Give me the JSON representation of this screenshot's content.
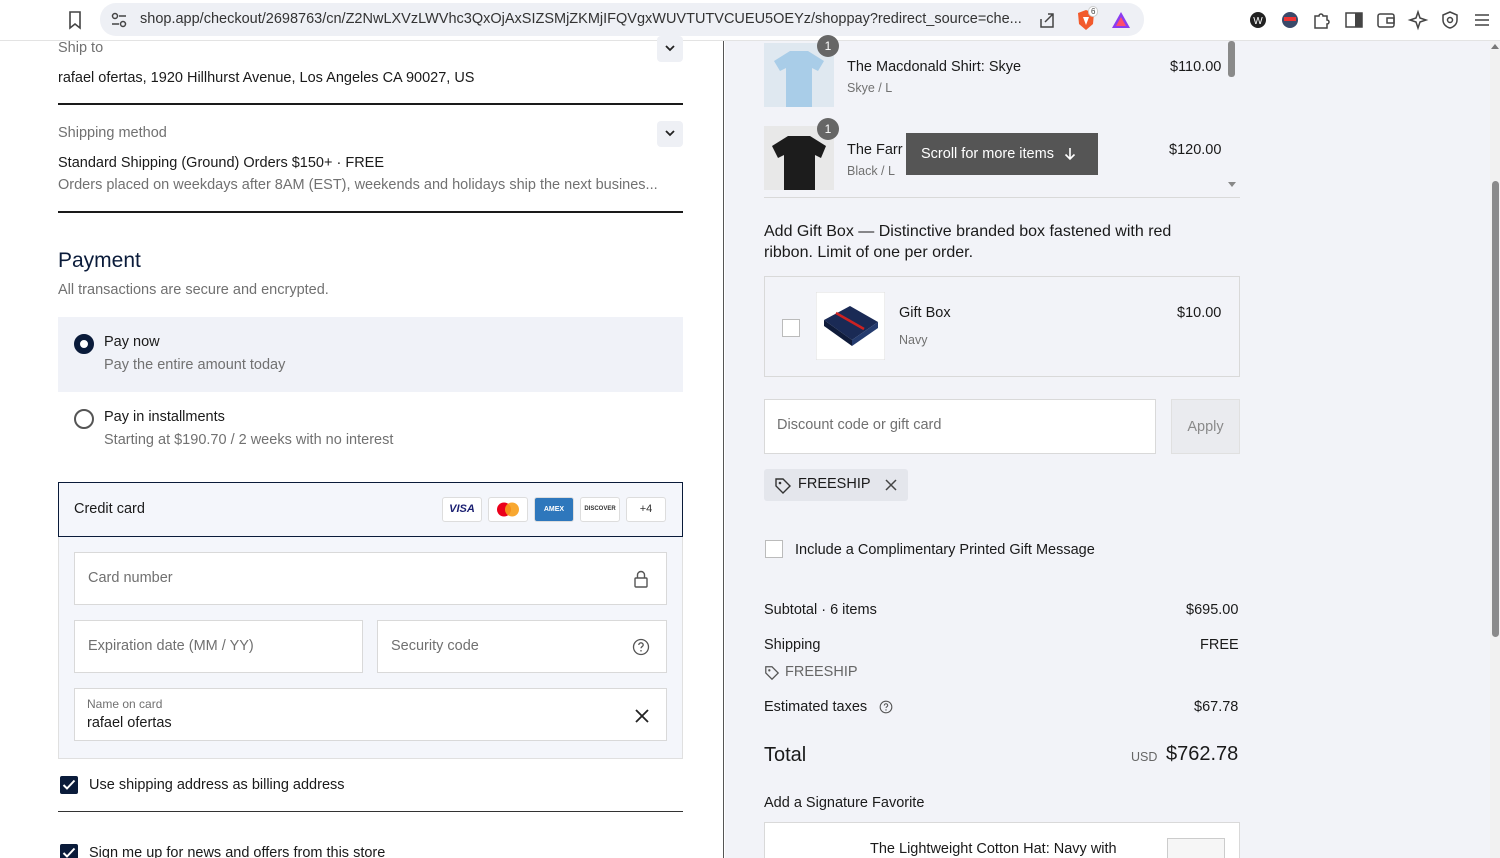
{
  "browser": {
    "url": "shop.app/checkout/2698763/cn/Z2NwLXVzLWVhc3QxOjAxSIZSMjZKMjIFQVgxWUVTUTVCUEU5OEYz/shoppay?redirect_source=che...",
    "brave_badge": "6",
    "icons": [
      "bookmark-icon",
      "tune-icon",
      "share-icon",
      "brave-shield-icon",
      "brave-rewards-icon",
      "extension-icon",
      "sidebar-icon",
      "wallet-icon",
      "leo-icon",
      "vpn-icon",
      "menu-icon"
    ]
  },
  "shipping": {
    "ship_to_label": "Ship to",
    "ship_to_value": "rafael ofertas, 1920 Hillhurst Avenue, Los Angeles CA 90027, US",
    "method_label": "Shipping method",
    "method_value": "Standard Shipping (Ground) Orders $150+ · FREE",
    "method_note": "Orders placed on weekdays after 8AM (EST), weekends and holidays ship the next busines..."
  },
  "payment": {
    "heading": "Payment",
    "subtitle": "All transactions are secure and encrypted.",
    "pay_now_label": "Pay now",
    "pay_now_sub": "Pay the entire amount today",
    "installments_label": "Pay in installments",
    "installments_sub": "Starting at $190.70 / 2 weeks with no interest",
    "credit_card_label": "Credit card",
    "card_brands": [
      "VISA",
      "MC",
      "AMEX",
      "DISCOVER"
    ],
    "more_brands": "+4",
    "card_number_placeholder": "Card number",
    "expiry_placeholder": "Expiration date (MM / YY)",
    "security_placeholder": "Security code",
    "name_label": "Name on card",
    "name_value": "rafael ofertas",
    "billing_same": "Use shipping address as billing address",
    "newsletter": "Sign me up for news and offers from this store"
  },
  "cart": {
    "items": [
      {
        "qty": "1",
        "name": "The Macdonald Shirt: Skye",
        "variant": "Skye / L",
        "price": "$110.00",
        "color": "#a9cde8"
      },
      {
        "qty": "1",
        "name": "The Farr",
        "variant": "Black / L",
        "price": "$120.00",
        "color": "#1c1c1c"
      }
    ],
    "scroll_tooltip": "Scroll for more items",
    "gift_box_heading": "Add Gift Box — Distinctive branded box fastened with red ribbon. Limit of one per order.",
    "gift_box": {
      "name": "Gift Box",
      "variant": "Navy",
      "price": "$10.00"
    },
    "discount_placeholder": "Discount code or gift card",
    "apply_label": "Apply",
    "applied_code": "FREESHIP",
    "gift_message": "Include a Complimentary Printed Gift Message"
  },
  "summary": {
    "subtotal_label": "Subtotal · 6 items",
    "subtotal_value": "$695.00",
    "shipping_label": "Shipping",
    "shipping_value": "FREE",
    "shipping_code": "FREESHIP",
    "taxes_label": "Estimated taxes",
    "taxes_value": "$67.78",
    "total_label": "Total",
    "total_currency": "USD",
    "total_value": "$762.78",
    "signature_heading": "Add a Signature Favorite",
    "signature_item": "The Lightweight Cotton Hat: Navy with"
  }
}
